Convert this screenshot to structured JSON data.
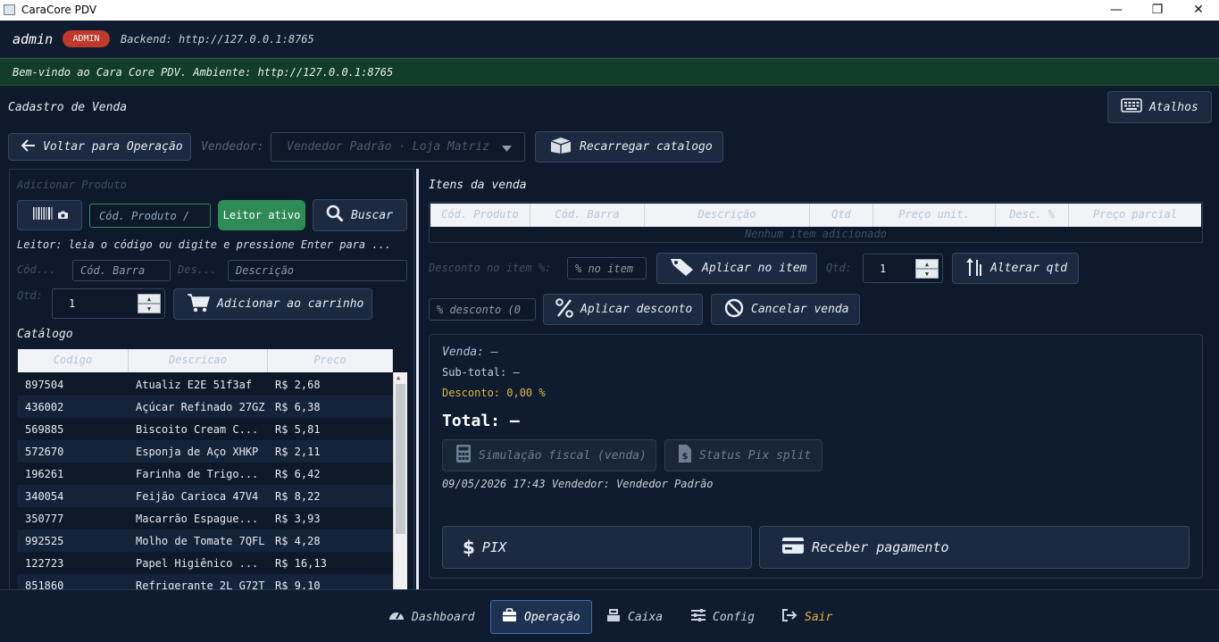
{
  "window": {
    "title": "CaraCore PDV",
    "minimize": "—",
    "maximize": "❐",
    "close": "✕"
  },
  "user": {
    "name": "admin",
    "role": "ADMIN",
    "backend": "Backend: http://127.0.0.1:8765"
  },
  "welcome": "Bem-vindo ao Cara Core PDV. Ambiente: http://127.0.0.1:8765",
  "page": {
    "title": "Cadastro de Venda",
    "shortcuts": "Atalhos"
  },
  "toolbar": {
    "back": "Voltar para Operação",
    "seller_label": "Vendedor:",
    "seller_value": "Vendedor Padrão · Loja Matriz",
    "reload": "Recarregar catalogo"
  },
  "add_product": {
    "title": "Adicionar Produto",
    "code_placeholder": "Cód. Produto /",
    "reader_status": "Leitor ativo",
    "search": "Buscar",
    "hint": "Leitor: leia o código ou digite e pressione Enter para ...",
    "cod_label": "Cód...",
    "barcode_placeholder": "Cód. Barra",
    "des_label": "Des...",
    "description_placeholder": "Descrição",
    "qty_label": "Qtd:",
    "qty_value": "1",
    "add_to_cart": "Adicionar ao carrinho"
  },
  "catalog": {
    "title": "Catálogo",
    "columns": [
      "Codigo",
      "Descricao",
      "Preco"
    ],
    "rows": [
      [
        "897504",
        "Atualiz E2E 51f3af",
        "R$ 2,68"
      ],
      [
        "436002",
        "Açúcar Refinado 27GZ",
        "R$ 6,38"
      ],
      [
        "569885",
        "Biscoito Cream C...",
        "R$ 5,81"
      ],
      [
        "572670",
        "Esponja de Aço XHKP",
        "R$ 2,11"
      ],
      [
        "196261",
        "Farinha de Trigo...",
        "R$ 6,42"
      ],
      [
        "340054",
        "Feijão Carioca 47V4",
        "R$ 8,22"
      ],
      [
        "350777",
        "Macarrão Espague...",
        "R$ 3,93"
      ],
      [
        "992525",
        "Molho de Tomate 7QFL",
        "R$ 4,28"
      ],
      [
        "122723",
        "Papel Higiênico ...",
        "R$ 16,13"
      ],
      [
        "851860",
        "Refrigerante 2L G72T",
        "R$ 9,10"
      ]
    ]
  },
  "items": {
    "title": "Itens da venda",
    "columns": [
      "Cód. Produto",
      "Cód. Barra",
      "Descrição",
      "Qtd",
      "Preço unit.",
      "Desc. %",
      "Preço parcial"
    ],
    "empty": "Nenhum item adicionado",
    "item_discount_label": "Desconto no item %:",
    "item_discount_placeholder": "% no item",
    "apply_item": "Aplicar no item",
    "qty_label": "Qtd:",
    "qty_value": "1",
    "change_qty": "Alterar qtd",
    "discount_placeholder": "% desconto (0",
    "apply_discount": "Aplicar desconto",
    "cancel_sale": "Cancelar venda"
  },
  "summary": {
    "sale": "Venda: —",
    "subtotal": "Sub-total: —",
    "discount": "Desconto: 0,00 %",
    "total": "Total: —",
    "fiscal": "Simulação fiscal (venda)",
    "pix_status": "Status Pix split",
    "meta": "09/05/2026 17:43  Vendedor: Vendedor Padrão",
    "pix": "PIX",
    "receive": "Receber pagamento"
  },
  "nav": {
    "dashboard": "Dashboard",
    "operacao": "Operação",
    "caixa": "Caixa",
    "config": "Config",
    "sair": "Sair"
  },
  "colors": {
    "accent": "#3d6ea8",
    "admin_badge": "#c0392b",
    "welcome_bg": "#123d2a",
    "discount": "#e0b341",
    "exit": "#e0b341"
  }
}
